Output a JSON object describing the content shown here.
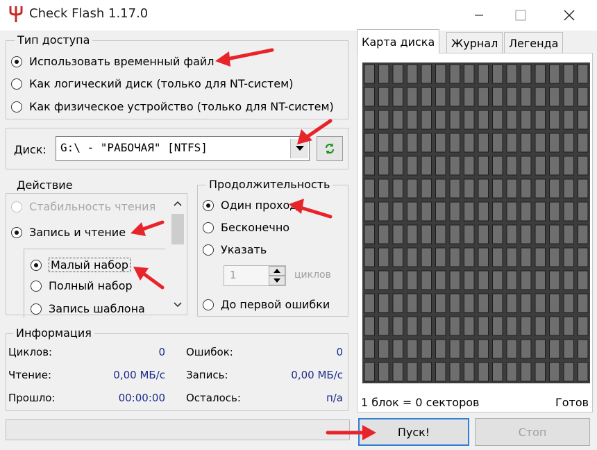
{
  "window": {
    "title": "Check Flash 1.17.0"
  },
  "access_type": {
    "legend": "Тип доступа",
    "options": [
      {
        "label": "Использовать временный файл",
        "checked": true
      },
      {
        "label": "Как логический диск (только для NT-систем)",
        "checked": false
      },
      {
        "label": "Как физическое устройство (только для NT-систем)",
        "checked": false
      }
    ]
  },
  "drive": {
    "label": "Диск:",
    "value": "G:\\ - \"РАБОЧАЯ\" [NTFS]"
  },
  "action": {
    "legend": "Действие",
    "options": [
      {
        "label": "Стабильность чтения",
        "checked": false,
        "disabled": true
      },
      {
        "label": "Запись и чтение",
        "checked": true
      }
    ],
    "sub_options": [
      {
        "label": "Малый набор",
        "checked": true
      },
      {
        "label": "Полный набор",
        "checked": false
      },
      {
        "label": "Запись шаблона",
        "checked": false
      }
    ]
  },
  "duration": {
    "legend": "Продолжительность",
    "options": [
      {
        "label": "Один проход",
        "checked": true
      },
      {
        "label": "Бесконечно",
        "checked": false
      },
      {
        "label": "Указать",
        "checked": false
      },
      {
        "label": "До первой ошибки",
        "checked": false
      }
    ],
    "cycles_value": "1",
    "cycles_unit": "циклов"
  },
  "info": {
    "legend": "Информация",
    "cycles_label": "Циклов:",
    "cycles_value": "0",
    "errors_label": "Ошибок:",
    "errors_value": "0",
    "read_label": "Чтение:",
    "read_value": "0,00 МБ/с",
    "write_label": "Запись:",
    "write_value": "0,00 МБ/с",
    "elapsed_label": "Прошло:",
    "elapsed_value": "00:00:00",
    "remaining_label": "Осталось:",
    "remaining_value": "п/а"
  },
  "tabs": [
    {
      "label": "Карта диска",
      "active": true
    },
    {
      "label": "Журнал",
      "active": false
    },
    {
      "label": "Легенда",
      "active": false
    }
  ],
  "map": {
    "status": "1 блок = 0 секторов",
    "ready": "Готов",
    "columns": 16,
    "rows": 14,
    "block_color": "#6e6e6e",
    "background_color": "#3d3d3d"
  },
  "buttons": {
    "start": "Пуск!",
    "stop": "Стоп"
  },
  "colors": {
    "accent": "#2f7dd6",
    "arrow": "#e8242a",
    "value_text": "#1c2b8c",
    "refresh_icon": "#1f8f1f",
    "app_icon": "#c62828"
  }
}
